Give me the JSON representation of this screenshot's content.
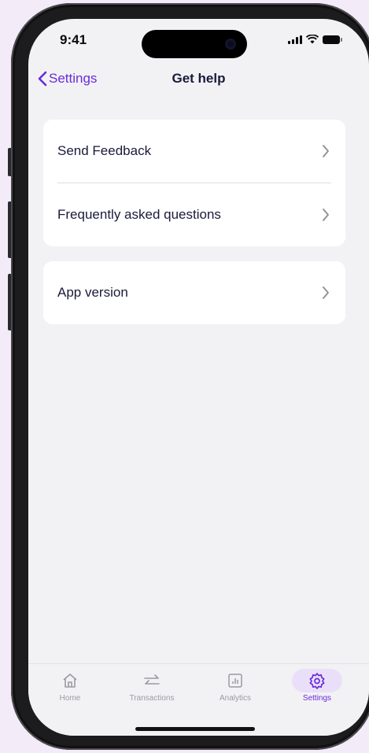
{
  "status_bar": {
    "time": "9:41"
  },
  "nav": {
    "back_label": "Settings",
    "title": "Get help"
  },
  "help_sections": [
    {
      "items": [
        {
          "label": "Send Feedback"
        },
        {
          "label": "Frequently asked questions"
        }
      ]
    },
    {
      "items": [
        {
          "label": "App version"
        }
      ]
    }
  ],
  "tab_bar": {
    "tabs": [
      {
        "label": "Home",
        "icon": "home-icon"
      },
      {
        "label": "Transactions",
        "icon": "transfer-arrows-icon"
      },
      {
        "label": "Analytics",
        "icon": "analytics-icon"
      },
      {
        "label": "Settings",
        "icon": "gear-icon",
        "active": true
      }
    ]
  },
  "colors": {
    "accent": "#6a2bd9",
    "title": "#1a1a3a",
    "background": "#f3ecf8"
  }
}
